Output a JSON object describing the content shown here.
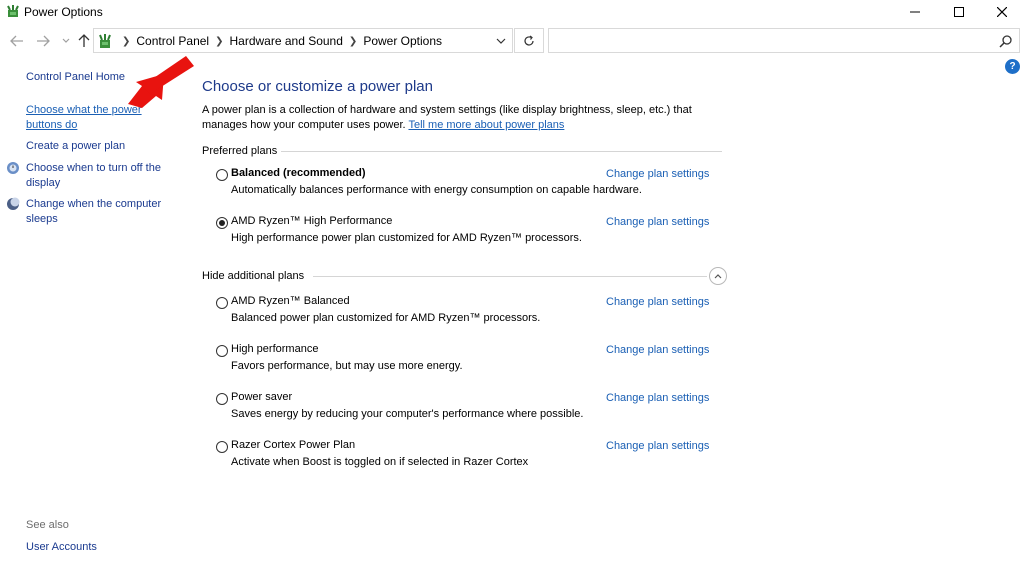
{
  "window": {
    "title": "Power Options",
    "minimize_label": "",
    "maximize_label": "",
    "close_label": ""
  },
  "address": {
    "crumbs": [
      "Control Panel",
      "Hardware and Sound",
      "Power Options"
    ],
    "search_placeholder": ""
  },
  "sidebar": {
    "home": "Control Panel Home",
    "items": [
      {
        "label_line1": "Choose what the power",
        "label_line2": "buttons do"
      },
      {
        "label_line1": "Create a power plan"
      },
      {
        "label_line1": "Choose when to turn off the",
        "label_line2": "display"
      },
      {
        "label_line1": "Change when the computer",
        "label_line2": "sleeps"
      }
    ],
    "see_also": "See also",
    "user_accounts": "User Accounts"
  },
  "main": {
    "heading": "Choose or customize a power plan",
    "description_line1": "A power plan is a collection of hardware and system settings (like display brightness, sleep, etc.) that",
    "description_line2": "manages how your computer uses power.",
    "description_link": "Tell me more about power plans",
    "preferred_label": "Preferred plans",
    "hide_label": "Hide additional plans",
    "change_label": "Change plan settings",
    "preferred_plans": [
      {
        "name": "Balanced (recommended)",
        "desc": "Automatically balances performance with energy consumption on capable hardware.",
        "selected": false,
        "bold": true
      },
      {
        "name": "AMD Ryzen™ High Performance",
        "desc": "High performance power plan customized for AMD Ryzen™ processors.",
        "selected": true,
        "bold": false
      }
    ],
    "additional_plans": [
      {
        "name": "AMD Ryzen™ Balanced",
        "desc": "Balanced power plan customized for AMD Ryzen™ processors.",
        "selected": false
      },
      {
        "name": "High performance",
        "desc": "Favors performance, but may use more energy.",
        "selected": false
      },
      {
        "name": "Power saver",
        "desc": "Saves energy by reducing your computer's performance where possible.",
        "selected": false
      },
      {
        "name": "Razer Cortex Power Plan",
        "desc": "Activate when Boost is toggled on if selected in Razer Cortex",
        "selected": false
      }
    ]
  },
  "colors": {
    "link": "#1a5fb4",
    "heading": "#1e3a8a",
    "arrow": "#e8130f"
  }
}
